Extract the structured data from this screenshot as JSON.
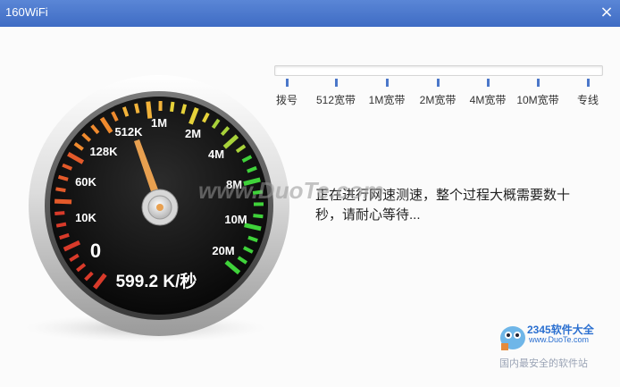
{
  "window": {
    "title": "160WiFi",
    "close_glyph": "×"
  },
  "speed_tiers": [
    "拨号",
    "512宽带",
    "1M宽带",
    "2M宽带",
    "4M宽带",
    "10M宽带",
    "专线"
  ],
  "gauge": {
    "scale_labels": [
      "0",
      "10K",
      "60K",
      "128K",
      "512K",
      "1M",
      "2M",
      "4M",
      "8M",
      "10M",
      "20M"
    ],
    "current_speed": "599.2 K/秒"
  },
  "status": {
    "message": "正在进行网速测速，整个过程大概需要数十秒，请耐心等待..."
  },
  "watermark": {
    "center": "www.DuoTe.com",
    "brand": "2345软件大全",
    "url": "www.DuoTe.com",
    "slogan": "国内最安全的软件站"
  },
  "colors": {
    "titlebar": "#4877cc",
    "tick": "#4b77c9"
  }
}
